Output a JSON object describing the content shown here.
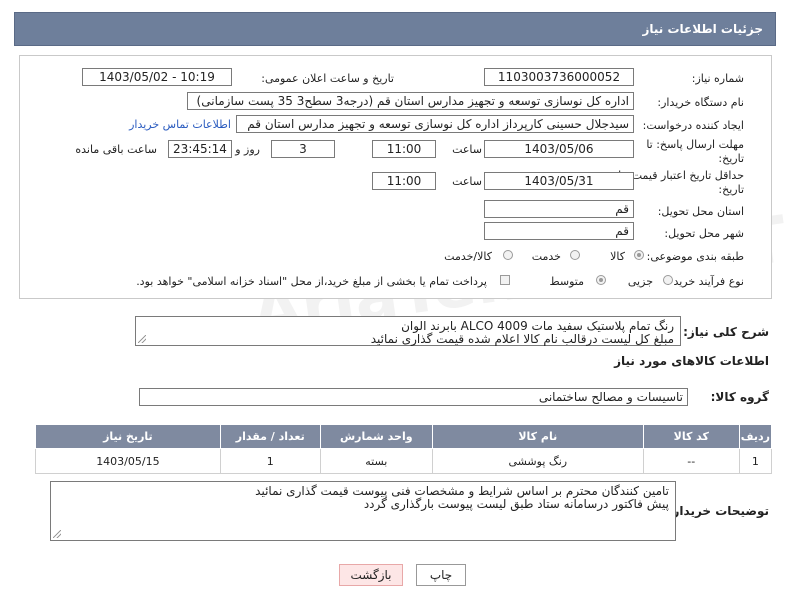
{
  "header": {
    "title": "جزئیات اطلاعات نیاز"
  },
  "form": {
    "need_number_label": "شماره نیاز:",
    "need_number": "1103003736000052",
    "announce_datetime_label": "تاریخ و ساعت اعلان عمومی:",
    "announce_datetime": "1403/05/02 - 10:19",
    "buyer_org_label": "نام دستگاه خریدار:",
    "buyer_org": "اداره کل نوسازی   توسعه و تجهیز مدارس استان قم (درجه3 سطح3  35 پست سازمانی)",
    "requester_label": "ایجاد کننده درخواست:",
    "requester": "سیدجلال حسینی کارپرداز اداره کل نوسازی   توسعه و تجهیز مدارس استان قم",
    "buyer_contact_link": "اطلاعات تماس خریدار",
    "reply_deadline_label_1": "مهلت ارسال پاسخ: تا",
    "reply_deadline_label_2": "تاریخ:",
    "reply_date": "1403/05/06",
    "time_label": "ساعت",
    "reply_time": "11:00",
    "days_value": "3",
    "days_label": "روز و",
    "remaining_time": "23:45:14",
    "remaining_label": "ساعت باقی مانده",
    "validity_label_1": "حداقل تاریخ اعتبار قیمت: تا",
    "validity_label_2": "تاریخ:",
    "validity_date": "1403/05/31",
    "validity_time": "11:00",
    "province_label": "استان محل تحویل:",
    "province": "قم",
    "city_label": "شهر محل تحویل:",
    "city": "قم",
    "category_label": "طبقه بندی موضوعی:",
    "category_options": [
      "کالا",
      "خدمت",
      "کالا/خدمت"
    ],
    "process_label": "نوع فرآیند خرید :",
    "process_options": [
      "جزیی",
      "متوسط"
    ],
    "payment_note": "پرداخت تمام یا بخشی از مبلغ خرید،از محل \"اسناد خزانه اسلامی\" خواهد بود."
  },
  "description": {
    "label": "شرح کلی نیاز:",
    "lines": [
      "رنگ تمام پلاستیک سفید مات ALCO 4009 بابرند الوان",
      "مبلغ کل لیست درقالب نام کالا اعلام شده قیمت گذاری نمائید"
    ]
  },
  "goods": {
    "section_title": "اطلاعات کالاهای مورد نیاز",
    "group_label": "گروه کالا:",
    "group_value": "تاسیسات و مصالح ساختمانی",
    "columns": [
      "ردیف",
      "کد کالا",
      "نام کالا",
      "واحد شمارش",
      "تعداد / مقدار",
      "تاریخ نیاز"
    ],
    "rows": [
      [
        "1",
        "--",
        "رنگ پوششی",
        "بسته",
        "1",
        "1403/05/15"
      ]
    ]
  },
  "buyer_notes": {
    "label": "توضیحات خریدار:",
    "lines": [
      "تامین کنندگان محترم بر اساس شرایط و مشخصات فنی پیوست قیمت گذاری نمائید",
      "پیش فاکتور درسامانه ستاد طبق لیست پیوست بارگذاری گردد"
    ]
  },
  "buttons": {
    "print": "چاپ",
    "back": "بازگشت"
  },
  "watermark": "AriaTender.neT",
  "colors": {
    "header_bg": "#6e7f9b",
    "table_header_bg": "#7f8aa0",
    "link": "#2a5bbf",
    "back_button_bg": "#fde6e6"
  }
}
